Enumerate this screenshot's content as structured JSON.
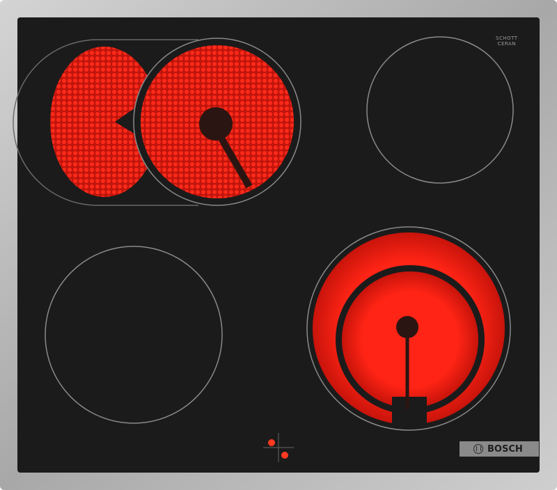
{
  "product": {
    "brand": "BOSCH",
    "glass_brand": "SCHOTT CERAN",
    "glass_brand_lines": [
      "SCHOTT",
      "CERAN"
    ],
    "frame_color": "#b8b8b8",
    "glass_color": "#1b1b1b",
    "heat_color": "#e81a10"
  },
  "zones": [
    {
      "name": "front-left-dual-zone",
      "state": "on"
    },
    {
      "name": "rear-right-zone",
      "state": "off"
    },
    {
      "name": "front-left-zone",
      "state": "off"
    },
    {
      "name": "front-right-dual-zone",
      "state": "on"
    }
  ],
  "indicators": {
    "residual_heat_lights": 2
  }
}
